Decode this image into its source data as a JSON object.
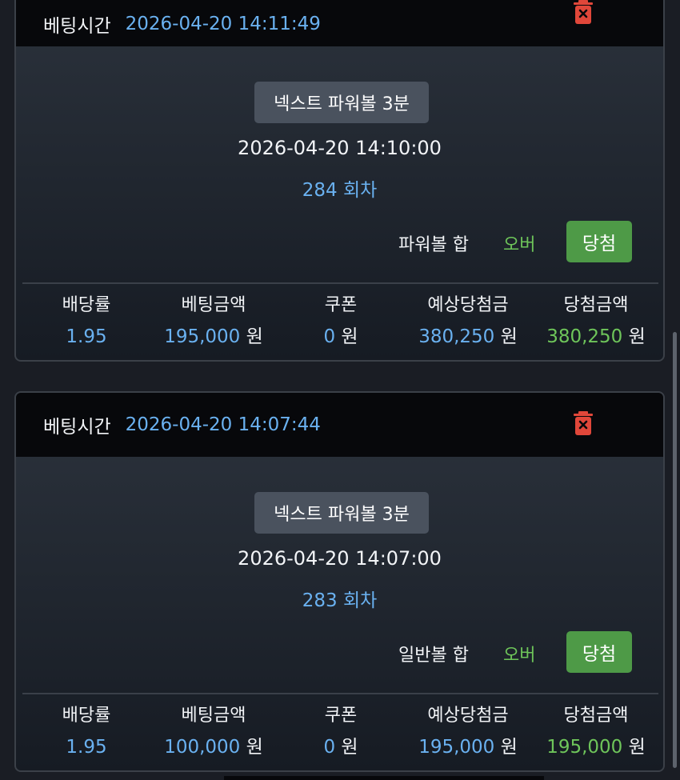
{
  "bets": [
    {
      "time_label": "베팅시간",
      "time": "2026-04-20 14:11:49",
      "game": "넥스트 파워볼 3분",
      "draw_time": "2026-04-20 14:10:00",
      "round": "284 회차",
      "pick_label": "파워볼 합",
      "pick_value": "오버",
      "result": "당첨",
      "stats": [
        {
          "label": "배당률",
          "value": "1.95",
          "unit": ""
        },
        {
          "label": "베팅금액",
          "value": "195,000",
          "unit": "원"
        },
        {
          "label": "쿠폰",
          "value": "0",
          "unit": "원"
        },
        {
          "label": "예상당첨금",
          "value": "380,250",
          "unit": "원"
        },
        {
          "label": "당첨금액",
          "value": "380,250",
          "unit": "원"
        }
      ]
    },
    {
      "time_label": "베팅시간",
      "time": "2026-04-20 14:07:44",
      "game": "넥스트 파워볼 3분",
      "draw_time": "2026-04-20 14:07:00",
      "round": "283 회차",
      "pick_label": "일반볼 합",
      "pick_value": "오버",
      "result": "당첨",
      "stats": [
        {
          "label": "배당률",
          "value": "1.95",
          "unit": ""
        },
        {
          "label": "베팅금액",
          "value": "100,000",
          "unit": "원"
        },
        {
          "label": "쿠폰",
          "value": "0",
          "unit": "원"
        },
        {
          "label": "예상당첨금",
          "value": "195,000",
          "unit": "원"
        },
        {
          "label": "당첨금액",
          "value": "195,000",
          "unit": "원"
        }
      ]
    }
  ],
  "icons": {
    "delete": "trash-icon"
  },
  "colors": {
    "accent_blue": "#6ab1f0",
    "win_green": "#4e9a47",
    "pick_green": "#6ec55a",
    "delete_red": "#e0473a"
  }
}
